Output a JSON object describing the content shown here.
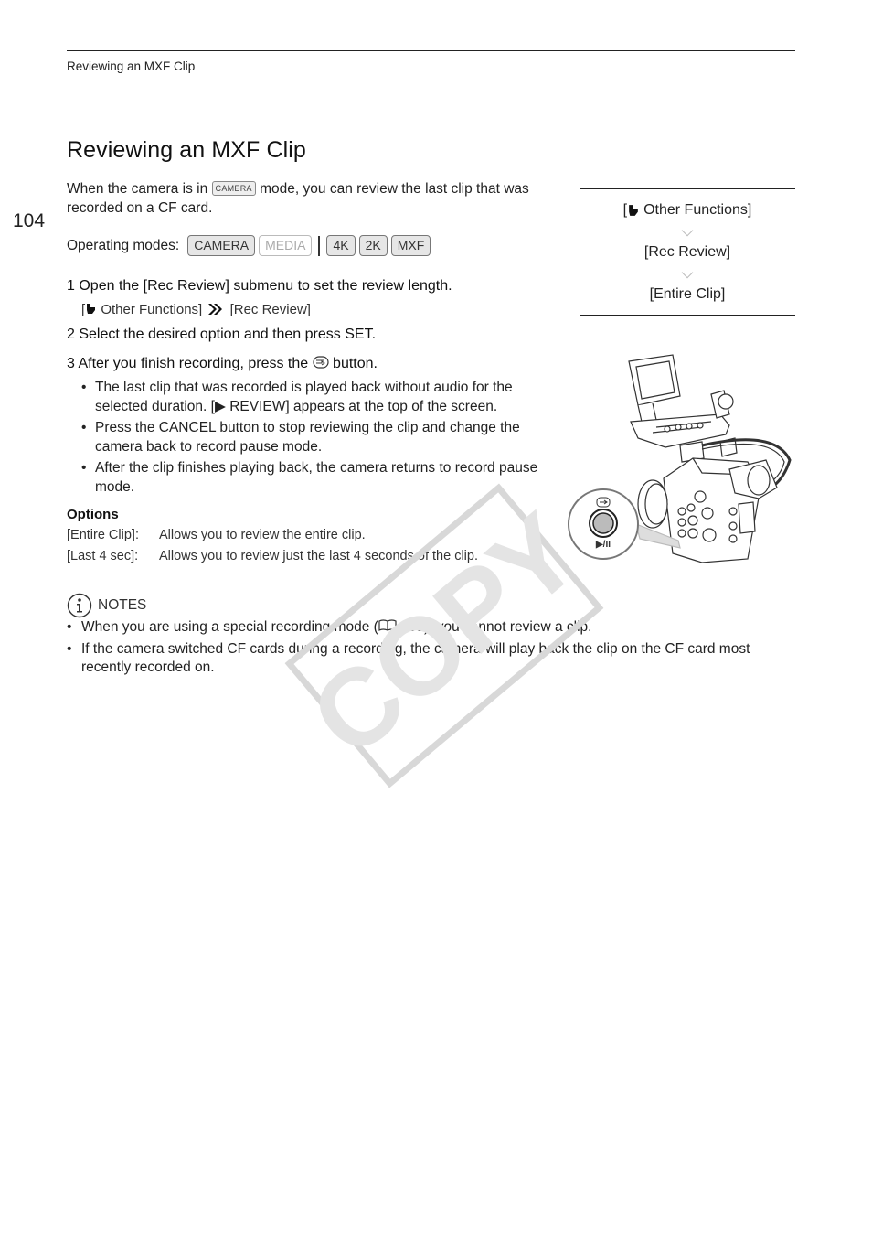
{
  "running_head": "Reviewing an MXF Clip",
  "page_number": "104",
  "title": "Reviewing an MXF Clip",
  "intro": {
    "before_badge": "When the camera is in ",
    "badge": "CAMERA",
    "after_badge": " mode, you can review the last clip that was recorded on a CF card."
  },
  "operating_modes": {
    "label": "Operating modes:",
    "modes": [
      {
        "label": "CAMERA",
        "active": true
      },
      {
        "label": "MEDIA",
        "active": false
      },
      {
        "label": "4K",
        "active": true
      },
      {
        "label": "2K",
        "active": true
      },
      {
        "label": "MXF",
        "active": true
      }
    ]
  },
  "steps": [
    {
      "number": "1",
      "text": "Open the [Rec Review] submenu to set the review length."
    },
    {
      "number": "2",
      "text": "Select the desired option and then press SET."
    },
    {
      "number": "3",
      "text_before": "After you finish recording, press the ",
      "icon": "playback-button-icon",
      "text_after": " button."
    }
  ],
  "menu_path": {
    "open": "[",
    "item1": " Other Functions]",
    "item2": "[Rec Review]"
  },
  "step3_bullets": [
    "The last clip that was recorded is played back without audio for the selected duration. [▶ REVIEW] appears at the top of the screen.",
    "Press the CANCEL button to stop reviewing the clip and change the camera back to record pause mode.",
    "After the clip finishes playing back, the camera returns to record pause mode."
  ],
  "options": {
    "heading": "Options",
    "items": [
      {
        "key": "[Entire Clip]:",
        "desc": "Allows you to review the entire clip."
      },
      {
        "key": "[Last 4 sec]:",
        "desc": "Allows you to review just the last 4 seconds of the clip."
      }
    ]
  },
  "menu_box": {
    "rows": [
      "Other Functions]",
      "[Rec Review]",
      "[Entire Clip]"
    ],
    "first_row_prefix": "["
  },
  "illustration": {
    "button_label": "▶/II"
  },
  "notes": {
    "heading": "NOTES",
    "items": [
      {
        "before": "When you are using a special recording mode (",
        "ref": " 105",
        "after": "), you cannot review a clip."
      },
      {
        "text": "If the camera switched CF cards during a recording, the camera will play back the clip on the CF card most recently recorded on."
      }
    ]
  },
  "watermark": "COPY"
}
